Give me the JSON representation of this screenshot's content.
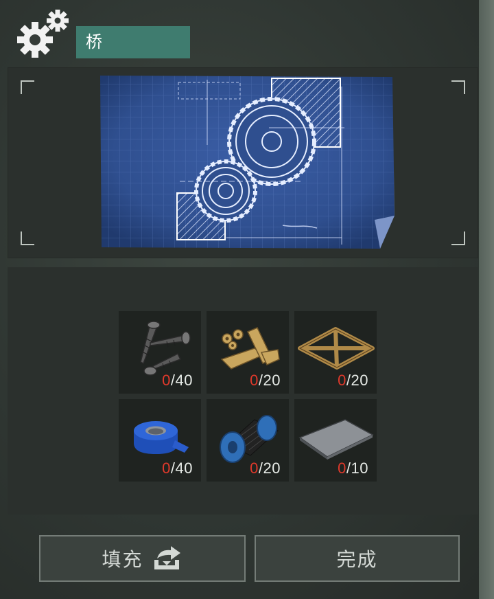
{
  "header": {
    "title": "桥",
    "icon": "gears-icon"
  },
  "blueprint": {
    "image": "blueprint-gears"
  },
  "materials": [
    {
      "name": "screws",
      "have": "0",
      "need": "40",
      "icon": "screws-icon"
    },
    {
      "name": "planks",
      "have": "0",
      "need": "20",
      "icon": "wood-planks-icon"
    },
    {
      "name": "frame",
      "have": "0",
      "need": "20",
      "icon": "wooden-frame-icon"
    },
    {
      "name": "tape",
      "have": "0",
      "need": "40",
      "icon": "blue-tape-icon"
    },
    {
      "name": "wire",
      "have": "0",
      "need": "20",
      "icon": "wire-spool-icon"
    },
    {
      "name": "plate",
      "have": "0",
      "need": "10",
      "icon": "metal-plate-icon"
    }
  ],
  "buttons": {
    "fill": "填充",
    "done": "完成"
  },
  "colors": {
    "title_bg": "#3f7c6f",
    "count_zero": "#e0392b",
    "blueprint": "#2f4f8f"
  }
}
